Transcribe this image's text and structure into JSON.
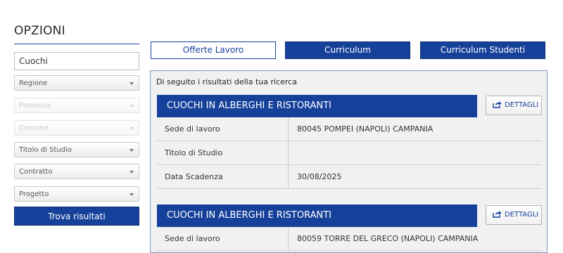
{
  "sidebar": {
    "title": "OPZIONI",
    "search_value": "Cuochi",
    "filters": [
      {
        "label": "Regione",
        "disabled": false
      },
      {
        "label": "Provincia",
        "disabled": true
      },
      {
        "label": "Comune",
        "disabled": true
      },
      {
        "label": "Titolo di Studio",
        "disabled": false
      },
      {
        "label": "Contratto",
        "disabled": false
      },
      {
        "label": "Progetto",
        "disabled": false
      }
    ],
    "submit_label": "Trova risultati"
  },
  "tabs": [
    {
      "label": "Offerte Lavoro",
      "active": true
    },
    {
      "label": "Curriculum",
      "active": false
    },
    {
      "label": "Curriculum Studenti",
      "active": false
    }
  ],
  "results": {
    "intro": "Di seguito i risultati della tua ricerca",
    "jobs": [
      {
        "title": "CUOCHI IN ALBERGHI E RISTORANTI",
        "details_label": "DETTAGLI",
        "rows": [
          {
            "label": "Sede di lavoro",
            "value": "80045 POMPEI (NAPOLI) CAMPANIA"
          },
          {
            "label": "Titolo di Studio",
            "value": ""
          },
          {
            "label": "Data Scadenza",
            "value": "30/08/2025"
          }
        ]
      },
      {
        "title": "CUOCHI IN ALBERGHI E RISTORANTI",
        "details_label": "DETTAGLI",
        "rows": [
          {
            "label": "Sede di lavoro",
            "value": "80059 TORRE DEL GRECO (NAPOLI) CAMPANIA"
          }
        ]
      }
    ]
  },
  "colors": {
    "primary": "#16419a",
    "panel_bg": "#f1f1f1",
    "panel_border": "#7f96c5"
  }
}
